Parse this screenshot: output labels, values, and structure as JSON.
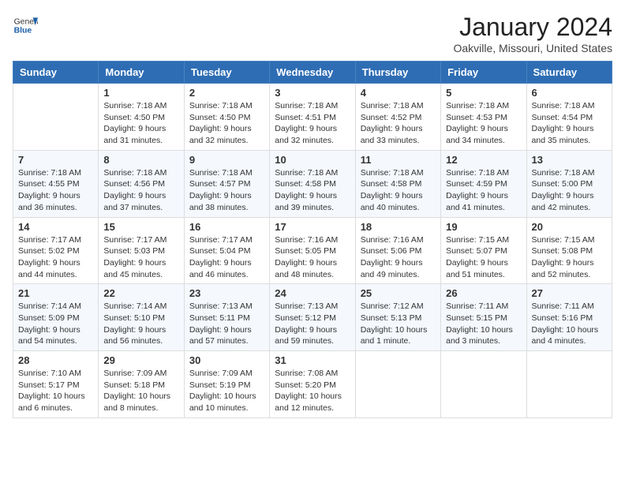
{
  "header": {
    "logo_general": "General",
    "logo_blue": "Blue",
    "title": "January 2024",
    "subtitle": "Oakville, Missouri, United States"
  },
  "days_of_week": [
    "Sunday",
    "Monday",
    "Tuesday",
    "Wednesday",
    "Thursday",
    "Friday",
    "Saturday"
  ],
  "weeks": [
    [
      {
        "day": "",
        "info": ""
      },
      {
        "day": "1",
        "info": "Sunrise: 7:18 AM\nSunset: 4:50 PM\nDaylight: 9 hours\nand 31 minutes."
      },
      {
        "day": "2",
        "info": "Sunrise: 7:18 AM\nSunset: 4:50 PM\nDaylight: 9 hours\nand 32 minutes."
      },
      {
        "day": "3",
        "info": "Sunrise: 7:18 AM\nSunset: 4:51 PM\nDaylight: 9 hours\nand 32 minutes."
      },
      {
        "day": "4",
        "info": "Sunrise: 7:18 AM\nSunset: 4:52 PM\nDaylight: 9 hours\nand 33 minutes."
      },
      {
        "day": "5",
        "info": "Sunrise: 7:18 AM\nSunset: 4:53 PM\nDaylight: 9 hours\nand 34 minutes."
      },
      {
        "day": "6",
        "info": "Sunrise: 7:18 AM\nSunset: 4:54 PM\nDaylight: 9 hours\nand 35 minutes."
      }
    ],
    [
      {
        "day": "7",
        "info": "Sunrise: 7:18 AM\nSunset: 4:55 PM\nDaylight: 9 hours\nand 36 minutes."
      },
      {
        "day": "8",
        "info": "Sunrise: 7:18 AM\nSunset: 4:56 PM\nDaylight: 9 hours\nand 37 minutes."
      },
      {
        "day": "9",
        "info": "Sunrise: 7:18 AM\nSunset: 4:57 PM\nDaylight: 9 hours\nand 38 minutes."
      },
      {
        "day": "10",
        "info": "Sunrise: 7:18 AM\nSunset: 4:58 PM\nDaylight: 9 hours\nand 39 minutes."
      },
      {
        "day": "11",
        "info": "Sunrise: 7:18 AM\nSunset: 4:58 PM\nDaylight: 9 hours\nand 40 minutes."
      },
      {
        "day": "12",
        "info": "Sunrise: 7:18 AM\nSunset: 4:59 PM\nDaylight: 9 hours\nand 41 minutes."
      },
      {
        "day": "13",
        "info": "Sunrise: 7:18 AM\nSunset: 5:00 PM\nDaylight: 9 hours\nand 42 minutes."
      }
    ],
    [
      {
        "day": "14",
        "info": "Sunrise: 7:17 AM\nSunset: 5:02 PM\nDaylight: 9 hours\nand 44 minutes."
      },
      {
        "day": "15",
        "info": "Sunrise: 7:17 AM\nSunset: 5:03 PM\nDaylight: 9 hours\nand 45 minutes."
      },
      {
        "day": "16",
        "info": "Sunrise: 7:17 AM\nSunset: 5:04 PM\nDaylight: 9 hours\nand 46 minutes."
      },
      {
        "day": "17",
        "info": "Sunrise: 7:16 AM\nSunset: 5:05 PM\nDaylight: 9 hours\nand 48 minutes."
      },
      {
        "day": "18",
        "info": "Sunrise: 7:16 AM\nSunset: 5:06 PM\nDaylight: 9 hours\nand 49 minutes."
      },
      {
        "day": "19",
        "info": "Sunrise: 7:15 AM\nSunset: 5:07 PM\nDaylight: 9 hours\nand 51 minutes."
      },
      {
        "day": "20",
        "info": "Sunrise: 7:15 AM\nSunset: 5:08 PM\nDaylight: 9 hours\nand 52 minutes."
      }
    ],
    [
      {
        "day": "21",
        "info": "Sunrise: 7:14 AM\nSunset: 5:09 PM\nDaylight: 9 hours\nand 54 minutes."
      },
      {
        "day": "22",
        "info": "Sunrise: 7:14 AM\nSunset: 5:10 PM\nDaylight: 9 hours\nand 56 minutes."
      },
      {
        "day": "23",
        "info": "Sunrise: 7:13 AM\nSunset: 5:11 PM\nDaylight: 9 hours\nand 57 minutes."
      },
      {
        "day": "24",
        "info": "Sunrise: 7:13 AM\nSunset: 5:12 PM\nDaylight: 9 hours\nand 59 minutes."
      },
      {
        "day": "25",
        "info": "Sunrise: 7:12 AM\nSunset: 5:13 PM\nDaylight: 10 hours\nand 1 minute."
      },
      {
        "day": "26",
        "info": "Sunrise: 7:11 AM\nSunset: 5:15 PM\nDaylight: 10 hours\nand 3 minutes."
      },
      {
        "day": "27",
        "info": "Sunrise: 7:11 AM\nSunset: 5:16 PM\nDaylight: 10 hours\nand 4 minutes."
      }
    ],
    [
      {
        "day": "28",
        "info": "Sunrise: 7:10 AM\nSunset: 5:17 PM\nDaylight: 10 hours\nand 6 minutes."
      },
      {
        "day": "29",
        "info": "Sunrise: 7:09 AM\nSunset: 5:18 PM\nDaylight: 10 hours\nand 8 minutes."
      },
      {
        "day": "30",
        "info": "Sunrise: 7:09 AM\nSunset: 5:19 PM\nDaylight: 10 hours\nand 10 minutes."
      },
      {
        "day": "31",
        "info": "Sunrise: 7:08 AM\nSunset: 5:20 PM\nDaylight: 10 hours\nand 12 minutes."
      },
      {
        "day": "",
        "info": ""
      },
      {
        "day": "",
        "info": ""
      },
      {
        "day": "",
        "info": ""
      }
    ]
  ]
}
